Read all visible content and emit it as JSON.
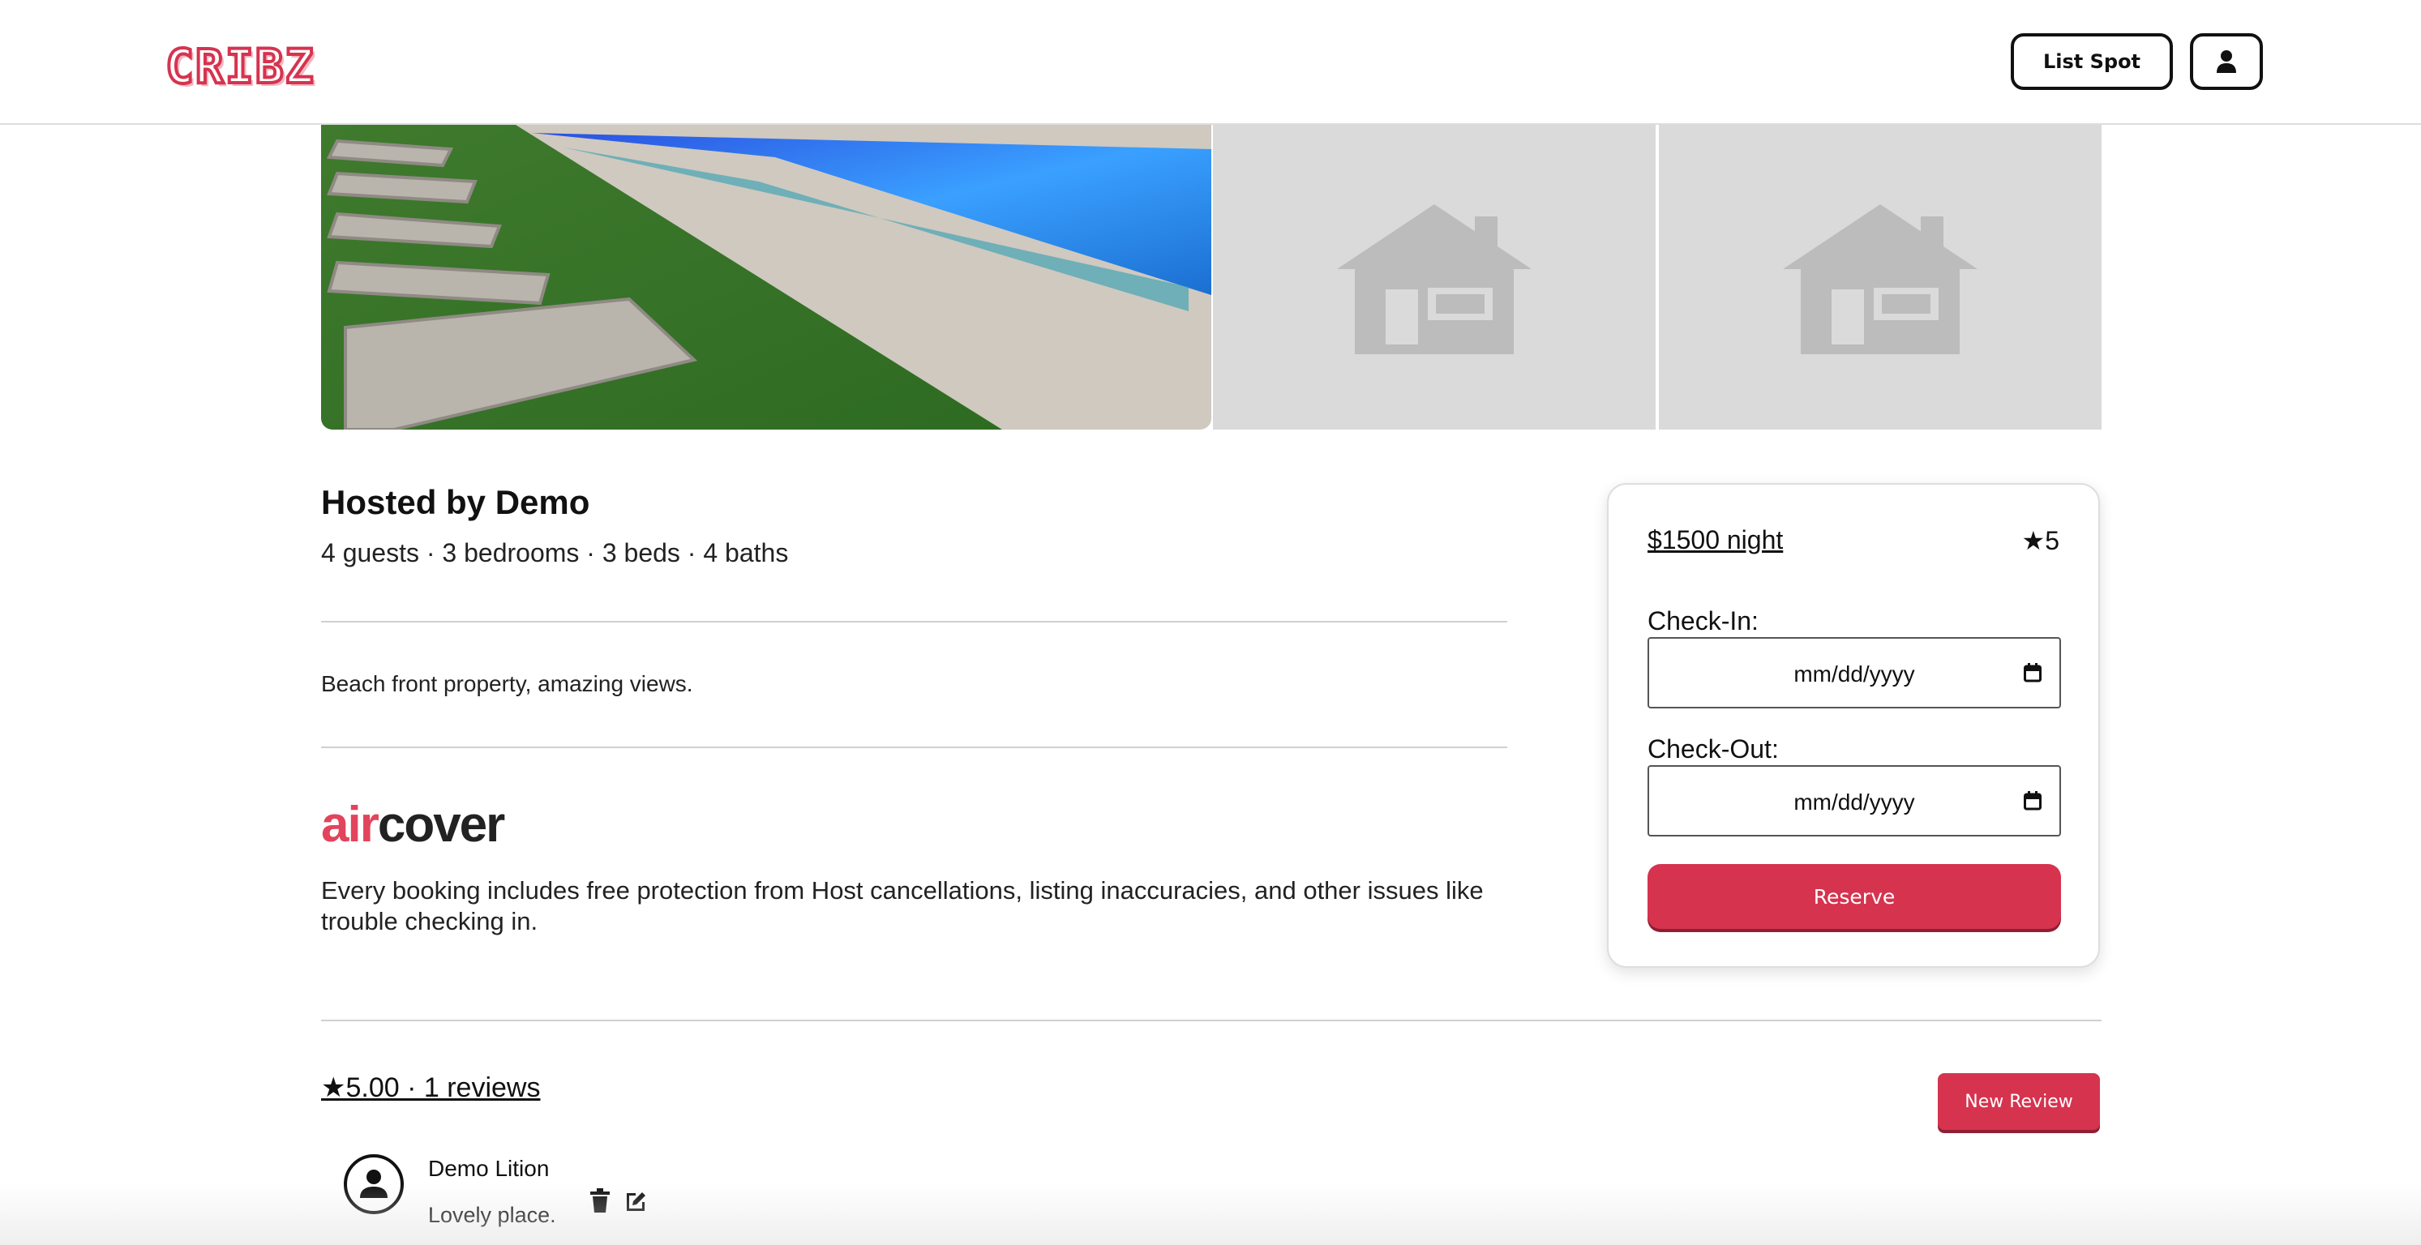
{
  "header": {
    "logo_text": "CRIBZ",
    "list_spot_label": "List Spot",
    "profile_icon": "user-icon"
  },
  "gallery": {
    "main_image": "pool-photo",
    "placeholder_icon": "house-icon"
  },
  "listing": {
    "host_title": "Hosted by Demo",
    "stats": "4 guests · 3 bedrooms · 3 beds · 4 baths",
    "description": "Beach front property, amazing views.",
    "aircover_air": "air",
    "aircover_cover": "cover",
    "aircover_text": "Every booking includes free protection from Host cancellations, listing inaccuracies, and other issues like trouble checking in."
  },
  "booking": {
    "price": "$1500 night",
    "rating": "★5",
    "checkin_label": "Check-In:",
    "checkout_label": "Check-Out:",
    "checkin_value": "mm/dd/yyyy",
    "checkout_value": "mm/dd/yyyy",
    "reserve_label": "Reserve"
  },
  "reviews": {
    "summary": "★5.00 · 1 reviews",
    "new_review_label": "New Review",
    "items": [
      {
        "author": "Demo Lition",
        "text": "Lovely place."
      }
    ]
  },
  "colors": {
    "brand": "#d6334f",
    "aircover_red": "#e2445c",
    "placeholder_bg": "#dadada"
  }
}
